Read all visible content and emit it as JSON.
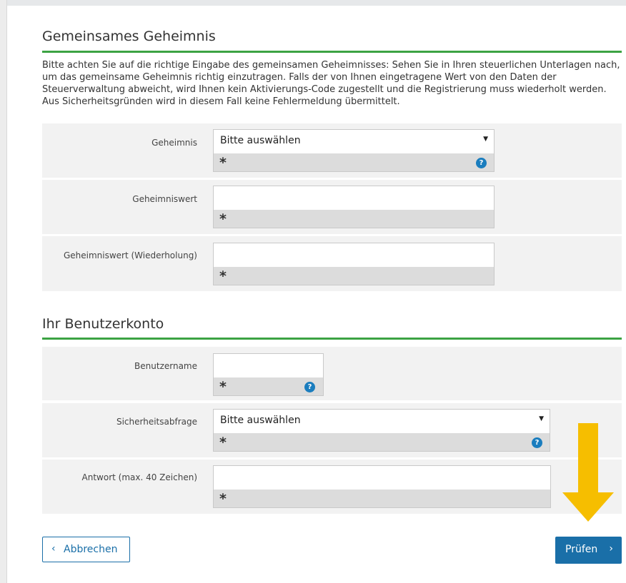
{
  "section1": {
    "title": "Gemeinsames Geheimnis",
    "intro": "Bitte achten Sie auf die richtige Eingabe des gemeinsamen Geheimnisses: Sehen Sie in Ihren steuerlichen Unterlagen nach, um das gemeinsame Geheimnis richtig einzutragen. Falls der von Ihnen eingetragene Wert von den Daten der Steuerverwaltung abweicht, wird Ihnen kein Aktivierungs-Code zugestellt und die Registrierung muss wiederholt werden. Aus Sicherheitsgründen wird in diesem Fall keine Fehlermeldung übermittelt.",
    "fields": {
      "geheimnis": {
        "label": "Geheimnis",
        "value": "Bitte auswählen"
      },
      "wert": {
        "label": "Geheimniswert",
        "value": ""
      },
      "wert_wdh": {
        "label": "Geheimniswert (Wiederholung)",
        "value": ""
      }
    }
  },
  "section2": {
    "title": "Ihr Benutzerkonto",
    "fields": {
      "benutzername": {
        "label": "Benutzername",
        "value": ""
      },
      "sicherheitsabfrage": {
        "label": "Sicherheitsabfrage",
        "value": "Bitte auswählen"
      },
      "antwort": {
        "label": "Antwort (max. 40 Zeichen)",
        "value": ""
      }
    }
  },
  "common": {
    "required_marker": "*",
    "help_glyph": "?",
    "caret": "▼"
  },
  "buttons": {
    "cancel": "Abbrechen",
    "cancel_icon": "‹",
    "submit": "Prüfen",
    "submit_icon": "›"
  },
  "colors": {
    "accent_green": "#3ca343",
    "primary_blue": "#1a6fa8",
    "help_blue": "#1a7dbe",
    "arrow_yellow": "#f6be00"
  }
}
